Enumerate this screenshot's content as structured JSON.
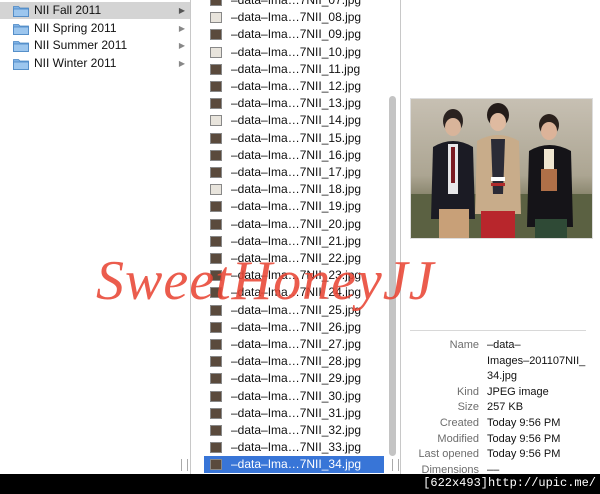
{
  "column1": {
    "folders": [
      {
        "label": "NII Fall 2011",
        "selected": true
      },
      {
        "label": "NII Spring 2011",
        "selected": false
      },
      {
        "label": "NII Summer 2011",
        "selected": false
      },
      {
        "label": "NII Winter 2011",
        "selected": false
      }
    ],
    "arrow_glyph": "▶"
  },
  "column2": {
    "files": [
      {
        "label": "–data–Ima…7NII_07.jpg",
        "light": false
      },
      {
        "label": "–data–Ima…7NII_08.jpg",
        "light": true
      },
      {
        "label": "–data–Ima…7NII_09.jpg",
        "light": false
      },
      {
        "label": "–data–Ima…7NII_10.jpg",
        "light": true
      },
      {
        "label": "–data–Ima…7NII_11.jpg",
        "light": false
      },
      {
        "label": "–data–Ima…7NII_12.jpg",
        "light": false
      },
      {
        "label": "–data–Ima…7NII_13.jpg",
        "light": false
      },
      {
        "label": "–data–Ima…7NII_14.jpg",
        "light": true
      },
      {
        "label": "–data–Ima…7NII_15.jpg",
        "light": false
      },
      {
        "label": "–data–Ima…7NII_16.jpg",
        "light": false
      },
      {
        "label": "–data–Ima…7NII_17.jpg",
        "light": false
      },
      {
        "label": "–data–Ima…7NII_18.jpg",
        "light": true
      },
      {
        "label": "–data–Ima…7NII_19.jpg",
        "light": false
      },
      {
        "label": "–data–Ima…7NII_20.jpg",
        "light": false
      },
      {
        "label": "–data–Ima…7NII_21.jpg",
        "light": false
      },
      {
        "label": "–data–Ima…7NII_22.jpg",
        "light": false
      },
      {
        "label": "–data–Ima…7NII_23.jpg",
        "light": false
      },
      {
        "label": "–data–Ima…7NII_24.jpg",
        "light": false
      },
      {
        "label": "–data–Ima…7NII_25.jpg",
        "light": false
      },
      {
        "label": "–data–Ima…7NII_26.jpg",
        "light": false
      },
      {
        "label": "–data–Ima…7NII_27.jpg",
        "light": false
      },
      {
        "label": "–data–Ima…7NII_28.jpg",
        "light": false
      },
      {
        "label": "–data–Ima…7NII_29.jpg",
        "light": false
      },
      {
        "label": "–data–Ima…7NII_30.jpg",
        "light": false
      },
      {
        "label": "–data–Ima…7NII_31.jpg",
        "light": false
      },
      {
        "label": "–data–Ima…7NII_32.jpg",
        "light": false
      },
      {
        "label": "–data–Ima…7NII_33.jpg",
        "light": false
      },
      {
        "label": "–data–Ima…7NII_34.jpg",
        "light": false,
        "selected": true
      }
    ]
  },
  "preview": {
    "info": [
      {
        "key": "Name",
        "value": "–data–"
      },
      {
        "key": "",
        "value": "Images–201107NII_"
      },
      {
        "key": "",
        "value": "34.jpg"
      },
      {
        "key": "Kind",
        "value": "JPEG image"
      },
      {
        "key": "Size",
        "value": "257 KB"
      },
      {
        "key": "Created",
        "value": "Today 9:56 PM"
      },
      {
        "key": "Modified",
        "value": "Today 9:56 PM"
      },
      {
        "key": "Last opened",
        "value": "Today 9:56 PM"
      },
      {
        "key": "Dimensions",
        "value": "––"
      }
    ]
  },
  "watermark": "SweetHoneyJJ",
  "footer": {
    "upic_text": "[622x493]http://upic.me/"
  },
  "colors": {
    "selection": "#3875d7",
    "folder": "#7fb2e5",
    "watermark": "#e84634"
  }
}
